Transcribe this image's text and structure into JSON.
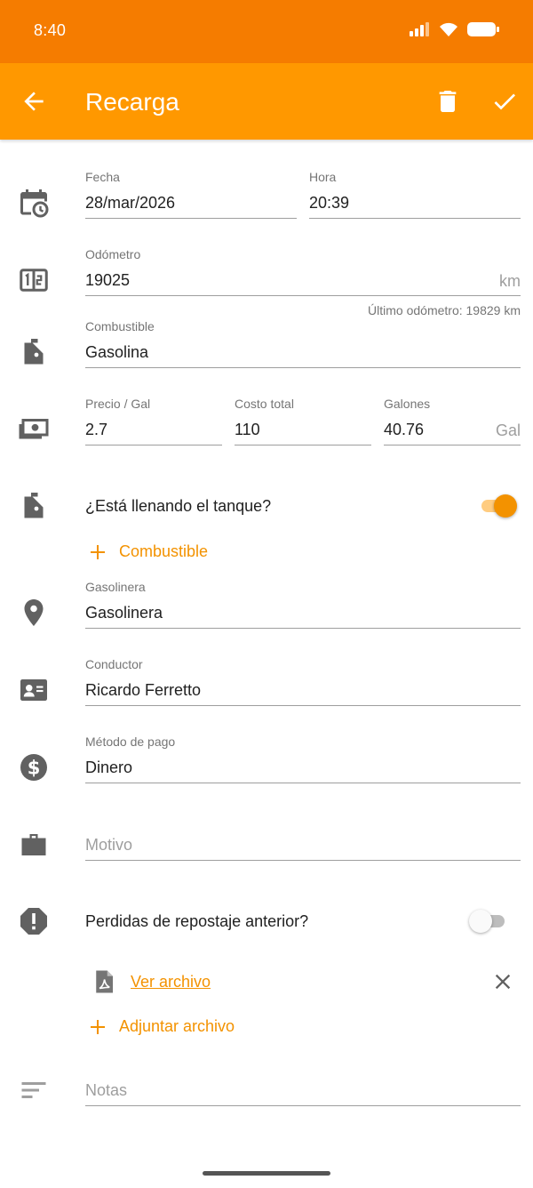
{
  "status_bar": {
    "time": "8:40"
  },
  "app_bar": {
    "title": "Recarga",
    "back_icon": "arrow-back-icon",
    "delete_icon": "trash-icon",
    "save_icon": "check-icon"
  },
  "colors": {
    "primary": "#FF9800",
    "primary_dark": "#F57C00",
    "accent": "#F39200"
  },
  "form": {
    "fecha": {
      "label": "Fecha",
      "value": "28/mar/2026"
    },
    "hora": {
      "label": "Hora",
      "value": "20:39"
    },
    "odometro": {
      "label": "Odómetro",
      "value": "19025",
      "suffix": "km",
      "helper": "Último odómetro: 19829 km"
    },
    "combustible": {
      "label": "Combustible",
      "value": "Gasolina"
    },
    "precio": {
      "label": "Precio / Gal",
      "value": "2.7"
    },
    "costo_total": {
      "label": "Costo total",
      "value": "110"
    },
    "galones": {
      "label": "Galones",
      "value": "40.76",
      "suffix": "Gal"
    },
    "tanque_lleno": {
      "label": "¿Está llenando el tanque?",
      "on": true
    },
    "add_fuel": {
      "label": "Combustible"
    },
    "gasolinera": {
      "label": "Gasolinera",
      "value": "Gasolinera"
    },
    "conductor": {
      "label": "Conductor",
      "value": "Ricardo Ferretto"
    },
    "metodo_pago": {
      "label": "Método de pago",
      "value": "Dinero"
    },
    "motivo": {
      "placeholder": "Motivo"
    },
    "perdidas": {
      "label": "Perdidas de repostaje anterior?",
      "on": false
    },
    "archivo": {
      "link": "Ver archivo"
    },
    "adjuntar": {
      "label": "Adjuntar archivo"
    },
    "notas": {
      "placeholder": "Notas"
    }
  }
}
